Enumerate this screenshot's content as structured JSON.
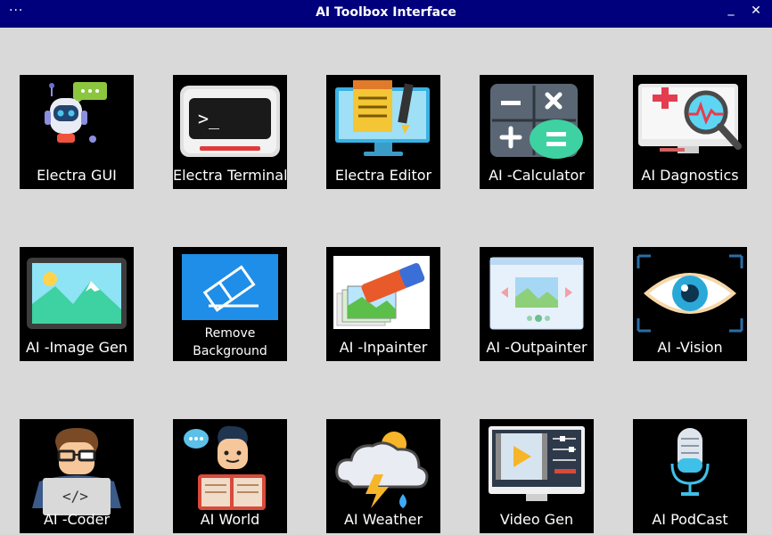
{
  "window": {
    "title": "AI Toolbox Interface",
    "menu_glyph": "···",
    "minimize_glyph": "_",
    "close_glyph": "✕"
  },
  "tools": [
    {
      "label": "Electra GUI",
      "icon": "robot-chat-icon"
    },
    {
      "label": "Electra Terminal",
      "icon": "terminal-icon"
    },
    {
      "label": "Electra Editor",
      "icon": "notepad-monitor-icon"
    },
    {
      "label": "AI -Calculator",
      "icon": "calculator-icon"
    },
    {
      "label": "AI Dagnostics",
      "icon": "diagnostics-monitor-icon"
    },
    {
      "label": "AI -Image Gen",
      "icon": "landscape-image-icon"
    },
    {
      "label_line1": "Remove",
      "label_line2": "Background",
      "icon": "eraser-background-icon"
    },
    {
      "label": "AI -Inpainter",
      "icon": "eraser-photos-icon"
    },
    {
      "label": "AI -Outpainter",
      "icon": "image-expand-icon"
    },
    {
      "label": "AI -Vision",
      "icon": "eye-icon"
    },
    {
      "label": "AI -Coder",
      "icon": "coder-person-icon"
    },
    {
      "label": "AI World",
      "icon": "reader-person-icon"
    },
    {
      "label": "AI Weather",
      "icon": "storm-cloud-icon"
    },
    {
      "label": "Video Gen",
      "icon": "video-editor-icon"
    },
    {
      "label": "AI PodCast",
      "icon": "microphone-icon"
    }
  ],
  "colors": {
    "titlebar": "#00007d",
    "background": "#d9d9d9",
    "tile": "#000000"
  }
}
